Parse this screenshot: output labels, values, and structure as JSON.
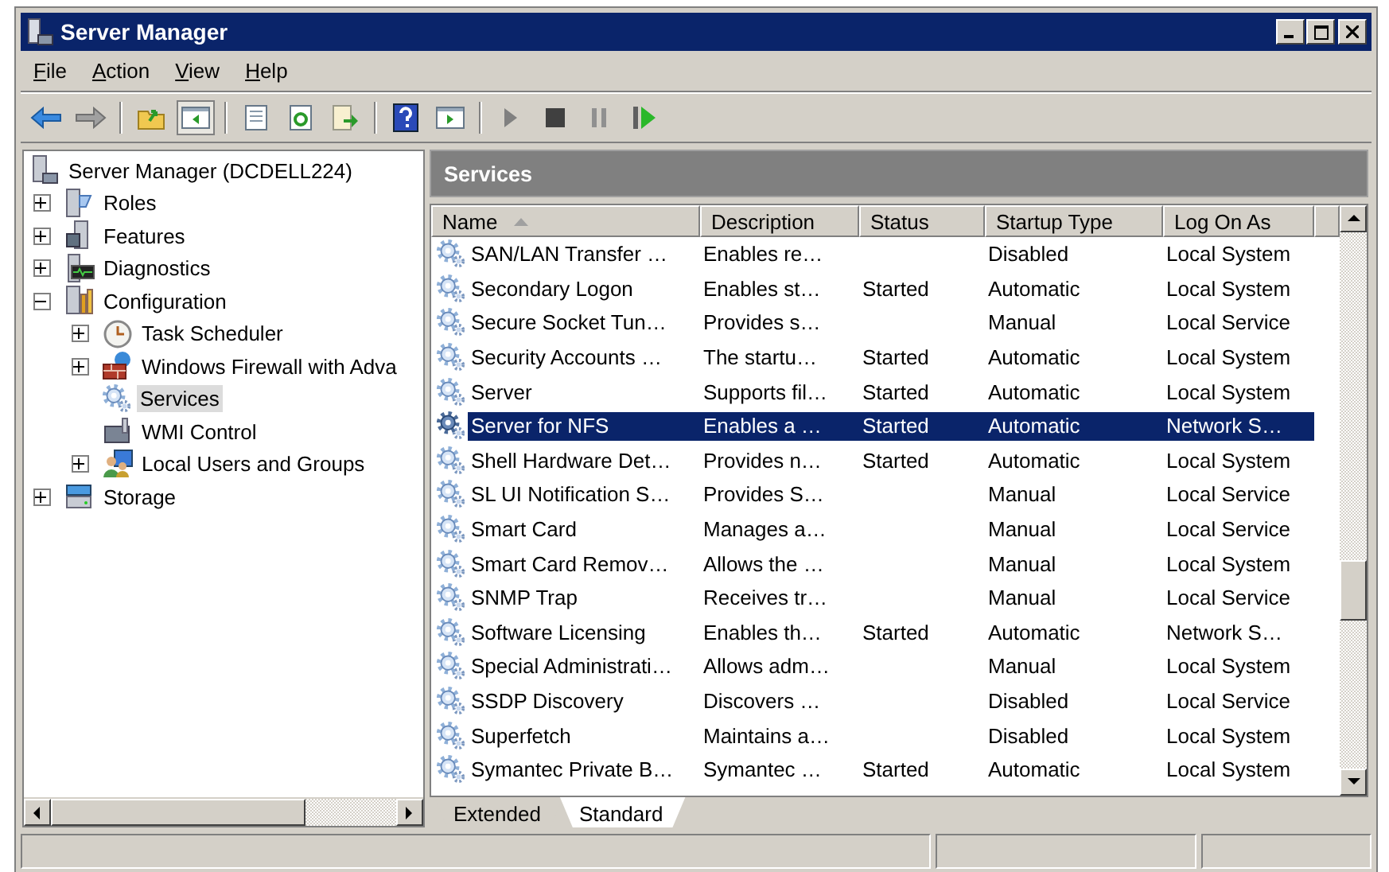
{
  "window": {
    "title": "Server Manager"
  },
  "menu": [
    {
      "label": "File"
    },
    {
      "label": "Action"
    },
    {
      "label": "View"
    },
    {
      "label": "Help"
    }
  ],
  "tree": {
    "label": "Server Manager (DCDELL224)",
    "kind": "server",
    "selected": false,
    "children": [
      {
        "label": "Roles",
        "kind": "roles",
        "expanded": false,
        "selected": false
      },
      {
        "label": "Features",
        "kind": "features",
        "expanded": false,
        "selected": false
      },
      {
        "label": "Diagnostics",
        "kind": "diagnostics",
        "expanded": false,
        "selected": false
      },
      {
        "label": "Configuration",
        "kind": "configuration",
        "expanded": true,
        "selected": false,
        "children": [
          {
            "label": "Task Scheduler",
            "kind": "clock",
            "expanded": false,
            "selected": false
          },
          {
            "label": "Windows Firewall with Adva",
            "kind": "firewall",
            "expanded": false,
            "selected": false
          },
          {
            "label": "Services",
            "kind": "gear",
            "selected": true
          },
          {
            "label": "WMI Control",
            "kind": "wmi",
            "selected": false
          },
          {
            "label": "Local Users and Groups",
            "kind": "users",
            "expanded": false,
            "selected": false
          }
        ]
      },
      {
        "label": "Storage",
        "kind": "storage",
        "expanded": false,
        "selected": false
      }
    ]
  },
  "panel": {
    "title": "Services"
  },
  "table": {
    "columns": [
      {
        "label": "Name",
        "sorted": true
      },
      {
        "label": "Description",
        "sorted": false
      },
      {
        "label": "Status",
        "sorted": false
      },
      {
        "label": "Startup Type",
        "sorted": false
      },
      {
        "label": "Log On As",
        "sorted": false
      }
    ],
    "rows": [
      {
        "cells": [
          "SAN/LAN Transfer …",
          "Enables re…",
          "",
          "Disabled",
          "Local System"
        ],
        "selected": false
      },
      {
        "cells": [
          "Secondary Logon",
          "Enables st…",
          "Started",
          "Automatic",
          "Local System"
        ],
        "selected": false
      },
      {
        "cells": [
          "Secure Socket Tun…",
          "Provides s…",
          "",
          "Manual",
          "Local Service"
        ],
        "selected": false
      },
      {
        "cells": [
          "Security Accounts …",
          "The startu…",
          "Started",
          "Automatic",
          "Local System"
        ],
        "selected": false
      },
      {
        "cells": [
          "Server",
          "Supports fil…",
          "Started",
          "Automatic",
          "Local System"
        ],
        "selected": false
      },
      {
        "cells": [
          "Server for NFS",
          "Enables a …",
          "Started",
          "Automatic",
          "Network S…"
        ],
        "selected": true
      },
      {
        "cells": [
          "Shell Hardware Det…",
          "Provides n…",
          "Started",
          "Automatic",
          "Local System"
        ],
        "selected": false
      },
      {
        "cells": [
          "SL UI Notification S…",
          "Provides S…",
          "",
          "Manual",
          "Local Service"
        ],
        "selected": false
      },
      {
        "cells": [
          "Smart Card",
          "Manages a…",
          "",
          "Manual",
          "Local Service"
        ],
        "selected": false
      },
      {
        "cells": [
          "Smart Card Remov…",
          "Allows the …",
          "",
          "Manual",
          "Local System"
        ],
        "selected": false
      },
      {
        "cells": [
          "SNMP Trap",
          "Receives tr…",
          "",
          "Manual",
          "Local Service"
        ],
        "selected": false
      },
      {
        "cells": [
          "Software Licensing",
          "Enables th…",
          "Started",
          "Automatic",
          "Network S…"
        ],
        "selected": false
      },
      {
        "cells": [
          "Special Administrati…",
          "Allows adm…",
          "",
          "Manual",
          "Local System"
        ],
        "selected": false
      },
      {
        "cells": [
          "SSDP Discovery",
          "Discovers …",
          "",
          "Disabled",
          "Local Service"
        ],
        "selected": false
      },
      {
        "cells": [
          "Superfetch",
          "Maintains a…",
          "",
          "Disabled",
          "Local System"
        ],
        "selected": false
      },
      {
        "cells": [
          "Symantec Private B…",
          "Symantec …",
          "Started",
          "Automatic",
          "Local System"
        ],
        "selected": false
      }
    ]
  },
  "view_tabs": [
    {
      "label": "Extended",
      "selected": false
    },
    {
      "label": "Standard",
      "selected": true
    }
  ]
}
